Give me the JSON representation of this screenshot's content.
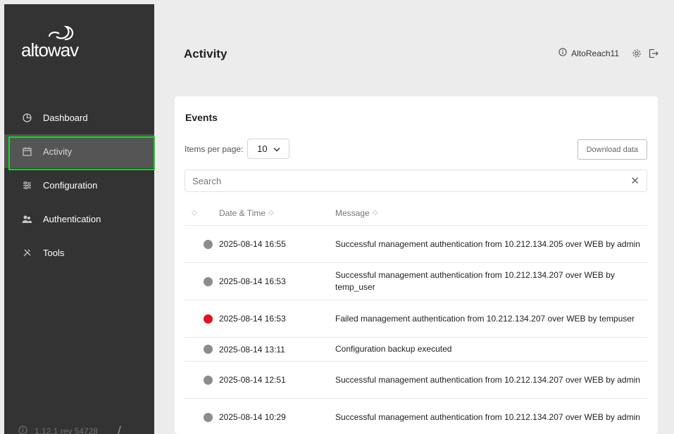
{
  "brand": {
    "logo_text": "altowav"
  },
  "sidebar": {
    "items": [
      {
        "label": "Dashboard",
        "icon": "pie-chart-icon"
      },
      {
        "label": "Activity",
        "icon": "calendar-icon",
        "active": true
      },
      {
        "label": "Configuration",
        "icon": "sliders-icon"
      },
      {
        "label": "Authentication",
        "icon": "users-icon"
      },
      {
        "label": "Tools",
        "icon": "tools-icon"
      }
    ],
    "version": "1.12.1 rev 54728",
    "collapse_glyph": "//"
  },
  "header": {
    "title": "Activity",
    "user": "AltoReach11"
  },
  "events": {
    "title": "Events",
    "items_per_page_label": "Items per page:",
    "items_per_page_value": "10",
    "download_label": "Download data",
    "search_placeholder": "Search",
    "columns": {
      "date": "Date & Time",
      "message": "Message"
    },
    "rows": [
      {
        "status": "info",
        "date": "2025-08-14 16:55",
        "message": "Successful management authentication from 10.212.134.205 over WEB by admin"
      },
      {
        "status": "info",
        "date": "2025-08-14 16:53",
        "message": "Successful management authentication from 10.212.134.207 over WEB by temp_user"
      },
      {
        "status": "error",
        "date": "2025-08-14 16:53",
        "message": "Failed management authentication from 10.212.134.207 over WEB by tempuser"
      },
      {
        "status": "info",
        "date": "2025-08-14 13:11",
        "message": "Configuration backup executed"
      },
      {
        "status": "info",
        "date": "2025-08-14 12:51",
        "message": "Successful management authentication from 10.212.134.207 over WEB by admin"
      },
      {
        "status": "info",
        "date": "2025-08-14 10:29",
        "message": "Successful management authentication from 10.212.134.207 over WEB by admin"
      }
    ]
  },
  "colors": {
    "sidebar_bg": "#333333",
    "active_bg": "#555555",
    "highlight": "#1ecf2a",
    "status_info": "#8c8c8c",
    "status_error": "#e8101c"
  }
}
